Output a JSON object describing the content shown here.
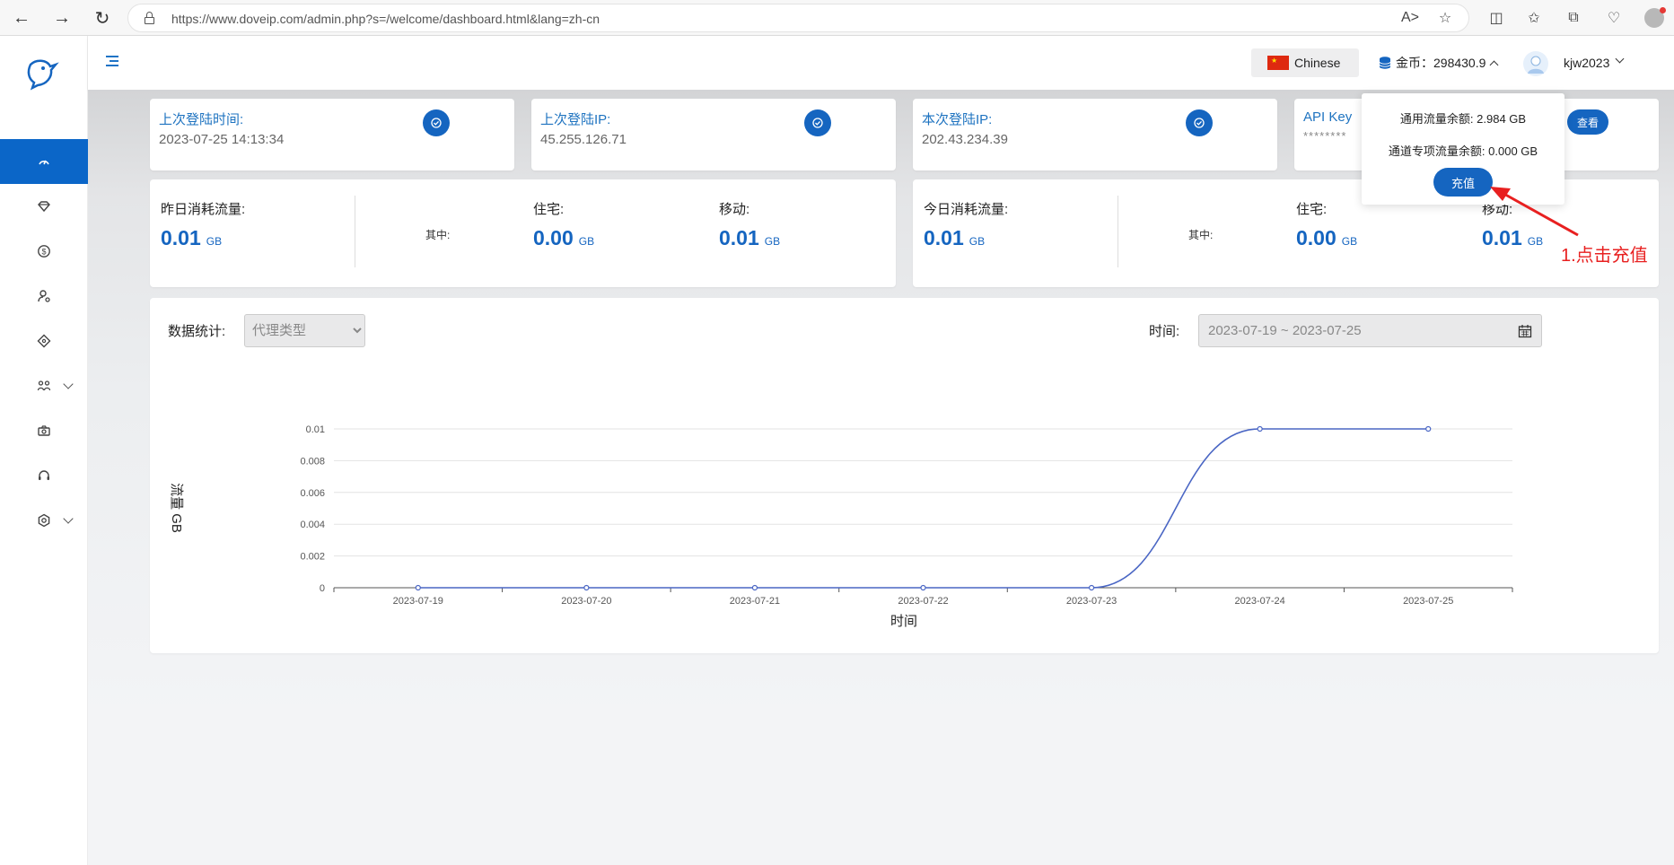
{
  "browser": {
    "url": "https://www.doveip.com/admin.php?s=/welcome/dashboard.html&lang=zh-cn"
  },
  "topbar": {
    "language": "Chinese",
    "coins_label": "金币：",
    "coins_value": "298430.9",
    "username": "kjw2023"
  },
  "info_cards": [
    {
      "title": "上次登陆时间:",
      "value": "2023-07-25 14:13:34"
    },
    {
      "title": "上次登陆IP:",
      "value": "45.255.126.71"
    },
    {
      "title": "本次登陆IP:",
      "value": "202.43.234.39"
    },
    {
      "title": "API Key",
      "value": "********",
      "button": "查看"
    }
  ],
  "traffic": {
    "yesterday": {
      "title": "昨日消耗流量:",
      "total": "0.01",
      "among": "其中:",
      "residential_label": "住宅:",
      "residential": "0.00",
      "mobile_label": "移动:",
      "mobile": "0.01",
      "unit": "GB"
    },
    "today": {
      "title": "今日消耗流量:",
      "total": "0.01",
      "among": "其中:",
      "residential_label": "住宅:",
      "residential": "0.00",
      "mobile_label": "移动:",
      "mobile": "0.01",
      "unit": "GB"
    }
  },
  "stats": {
    "label": "数据统计:",
    "type_placeholder": "代理类型",
    "time_label": "时间:",
    "date_range": "2023-07-19 ~ 2023-07-25"
  },
  "popup": {
    "general_balance": "通用流量余额: 2.984 GB",
    "channel_balance": "通道专项流量余额: 0.000 GB",
    "recharge": "充值"
  },
  "annotation": "1.点击充值",
  "colors": {
    "primary": "#1565c0",
    "line": "#4a66c4",
    "annotation": "#e82020"
  },
  "chart_data": {
    "type": "line",
    "categories": [
      "2023-07-19",
      "2023-07-20",
      "2023-07-21",
      "2023-07-22",
      "2023-07-23",
      "2023-07-24",
      "2023-07-25"
    ],
    "series": [
      {
        "values": [
          0,
          0,
          0,
          0,
          0,
          0.01,
          0.01
        ]
      }
    ],
    "yticks": [
      "0",
      "0.002",
      "0.004",
      "0.006",
      "0.008",
      "0.01"
    ],
    "ylim": [
      0,
      0.01
    ],
    "xlabel": "时间",
    "ylabel": "流量 GB",
    "grid": "horizontal",
    "smooth": true
  }
}
